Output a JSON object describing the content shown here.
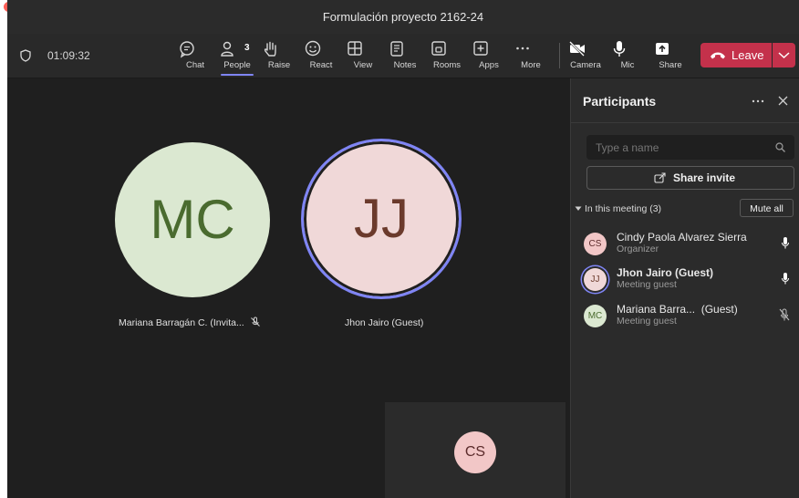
{
  "window": {
    "title": "Formulación proyecto 2162-24"
  },
  "toolbar": {
    "timer": "01:09:32",
    "buttons": [
      {
        "id": "chat",
        "label": "Chat",
        "icon": "chat-icon"
      },
      {
        "id": "people",
        "label": "People",
        "icon": "people-icon",
        "badge": "3"
      },
      {
        "id": "raise",
        "label": "Raise",
        "icon": "hand-icon"
      },
      {
        "id": "react",
        "label": "React",
        "icon": "smiley-icon"
      },
      {
        "id": "view",
        "label": "View",
        "icon": "grid-icon"
      },
      {
        "id": "notes",
        "label": "Notes",
        "icon": "notes-icon"
      },
      {
        "id": "rooms",
        "label": "Rooms",
        "icon": "rooms-icon"
      },
      {
        "id": "apps",
        "label": "Apps",
        "icon": "plus-box-icon"
      },
      {
        "id": "more",
        "label": "More",
        "icon": "ellipsis-icon"
      },
      {
        "id": "camera",
        "label": "Camera",
        "icon": "camera-off-icon"
      },
      {
        "id": "mic",
        "label": "Mic",
        "icon": "mic-icon"
      },
      {
        "id": "share",
        "label": "Share",
        "icon": "share-up-icon"
      }
    ],
    "leave_label": "Leave",
    "colors": {
      "leave": "#c4314b",
      "accent": "#7f85f5"
    }
  },
  "stage": {
    "tiles": [
      {
        "initials": "MC",
        "name": "Mariana Barragán C. (Invita...",
        "muted": true,
        "bg": "#dbe8d1",
        "fg": "#4a6b2f"
      },
      {
        "initials": "JJ",
        "name": "Jhon Jairo (Guest)",
        "muted": false,
        "speaking": true,
        "bg": "#f0d8d8",
        "fg": "#6b3a2c"
      }
    ],
    "self_tile": {
      "initials": "CS",
      "bg": "#f2c7c7",
      "fg": "#5b2b2b"
    }
  },
  "participants_panel": {
    "title": "Participants",
    "search_placeholder": "Type a name",
    "share_invite_label": "Share invite",
    "section_label": "In this meeting (3)",
    "mute_all_label": "Mute all",
    "participants": [
      {
        "initials": "CS",
        "name": "Cindy Paola Alvarez Sierra",
        "role": "Organizer",
        "mic": "on",
        "bg": "#f2c7c7",
        "fg": "#5b2b2b"
      },
      {
        "initials": "JJ",
        "name": "Jhon Jairo (Guest)",
        "role": "Meeting guest",
        "mic": "on",
        "bg": "#f0d8d8",
        "fg": "#6b3a2c"
      },
      {
        "initials": "MC",
        "name": "Mariana Barra...  (Guest)",
        "role": "Meeting guest",
        "mic": "off",
        "bg": "#dbe8d1",
        "fg": "#4a6b2f"
      }
    ]
  }
}
